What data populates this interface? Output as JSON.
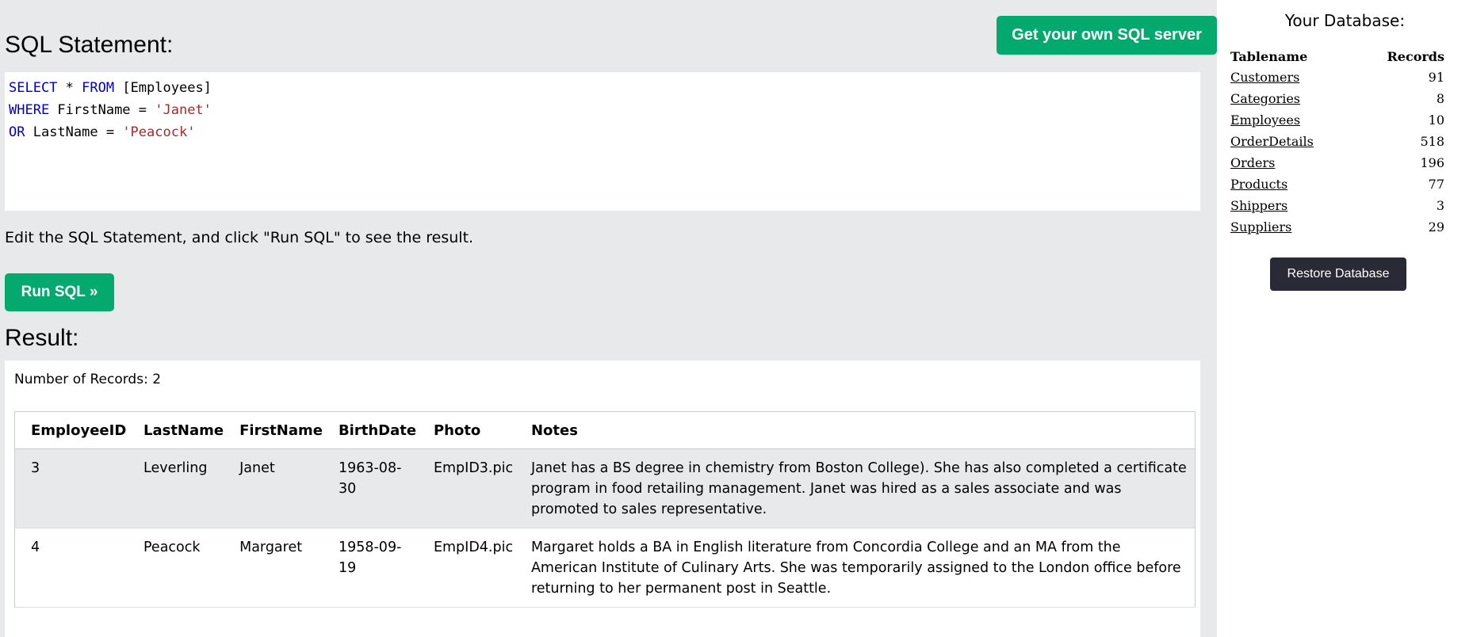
{
  "editor": {
    "heading": "SQL Statement:",
    "own_server_button": "Get your own SQL server",
    "code_lines": [
      [
        {
          "t": "SELECT",
          "c": "kw"
        },
        {
          "t": " * ",
          "c": ""
        },
        {
          "t": "FROM",
          "c": "kw"
        },
        {
          "t": " [Employees]",
          "c": ""
        }
      ],
      [
        {
          "t": "WHERE",
          "c": "kw"
        },
        {
          "t": " FirstName = ",
          "c": ""
        },
        {
          "t": "'Janet'",
          "c": "str"
        }
      ],
      [
        {
          "t": "OR",
          "c": "kw"
        },
        {
          "t": " LastName = ",
          "c": ""
        },
        {
          "t": "'Peacock'",
          "c": "str"
        }
      ]
    ],
    "instruction": "Edit the SQL Statement, and click \"Run SQL\" to see the result.",
    "run_button": "Run SQL »"
  },
  "result": {
    "heading": "Result:",
    "record_count": "Number of Records: 2",
    "columns": [
      "EmployeeID",
      "LastName",
      "FirstName",
      "BirthDate",
      "Photo",
      "Notes"
    ],
    "rows": [
      [
        "3",
        "Leverling",
        "Janet",
        "1963-08-30",
        "EmpID3.pic",
        "Janet has a BS degree in chemistry from Boston College). She has also completed a certificate program in food retailing management. Janet was hired as a sales associate and was promoted to sales representative."
      ],
      [
        "4",
        "Peacock",
        "Margaret",
        "1958-09-19",
        "EmpID4.pic",
        "Margaret holds a BA in English literature from Concordia College and an MA from the American Institute of Culinary Arts. She was temporarily assigned to the London office before returning to her permanent post in Seattle."
      ]
    ]
  },
  "database": {
    "title": "Your Database:",
    "header_tablename": "Tablename",
    "header_records": "Records",
    "tables": [
      {
        "name": "Customers",
        "records": "91"
      },
      {
        "name": "Categories",
        "records": "8"
      },
      {
        "name": "Employees",
        "records": "10"
      },
      {
        "name": "OrderDetails",
        "records": "518"
      },
      {
        "name": "Orders",
        "records": "196"
      },
      {
        "name": "Products",
        "records": "77"
      },
      {
        "name": "Shippers",
        "records": "3"
      },
      {
        "name": "Suppliers",
        "records": "29"
      }
    ],
    "restore_button": "Restore Database"
  },
  "colors": {
    "accent_green": "#04aa6d",
    "panel_gray": "#e7e9eb",
    "dark_button": "#282a35",
    "sql_keyword": "#0000cd",
    "sql_string": "#a52a2a"
  }
}
